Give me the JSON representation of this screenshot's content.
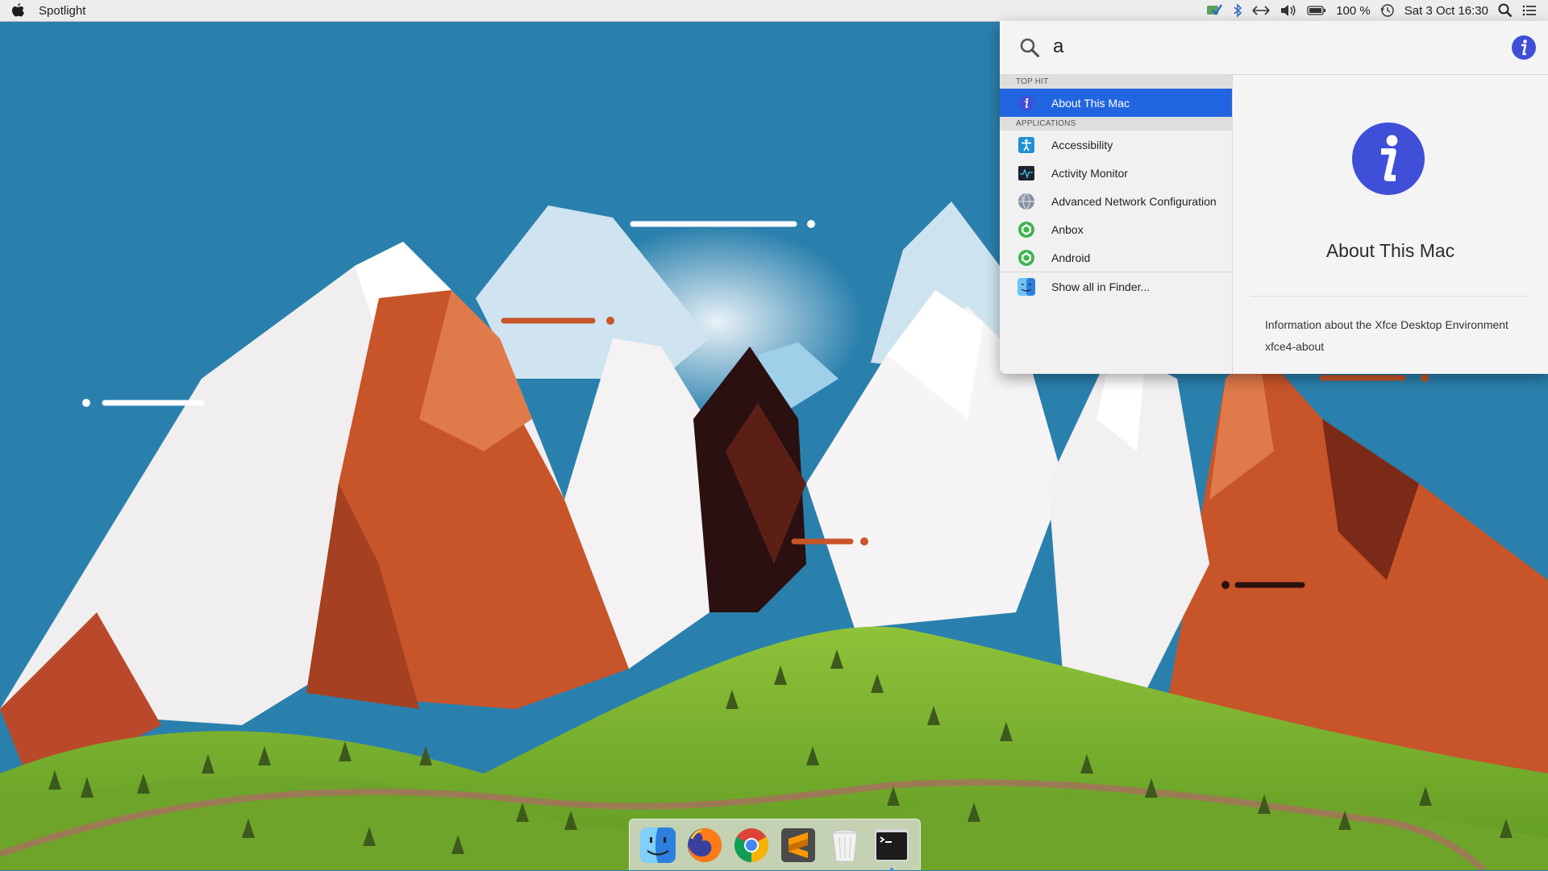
{
  "menubar": {
    "app_name": "Spotlight",
    "battery": "100 %",
    "datetime": "Sat 3 Oct  16:30",
    "icons": [
      "apple-icon",
      "network-manager-icon",
      "bluetooth-icon",
      "network-arrows-icon",
      "volume-icon",
      "battery-icon",
      "time-machine-icon",
      "spotlight-search-icon",
      "menu-list-icon"
    ]
  },
  "spotlight": {
    "query": "a",
    "sections": {
      "top_hit": "TOP HIT",
      "applications": "APPLICATIONS"
    },
    "top_hit": {
      "label": "About This Mac",
      "icon": "info-icon"
    },
    "applications": [
      {
        "label": "Accessibility",
        "icon": "accessibility-icon"
      },
      {
        "label": "Activity Monitor",
        "icon": "activity-monitor-icon"
      },
      {
        "label": "Advanced Network Configuration",
        "icon": "network-globe-icon"
      },
      {
        "label": "Anbox",
        "icon": "anbox-icon"
      },
      {
        "label": "Android",
        "icon": "android-icon"
      }
    ],
    "show_all": {
      "label": "Show all in Finder...",
      "icon": "finder-icon"
    },
    "preview": {
      "title": "About This Mac",
      "description": "Information about the Xfce Desktop Environment",
      "command": "xfce4-about"
    }
  },
  "dock": {
    "items": [
      "finder",
      "firefox",
      "chrome",
      "sublime-text",
      "trash",
      "terminal"
    ]
  },
  "colors": {
    "sky": "#2a80ad",
    "selection": "#2265e0",
    "info_icon": "#3f4fd8"
  }
}
